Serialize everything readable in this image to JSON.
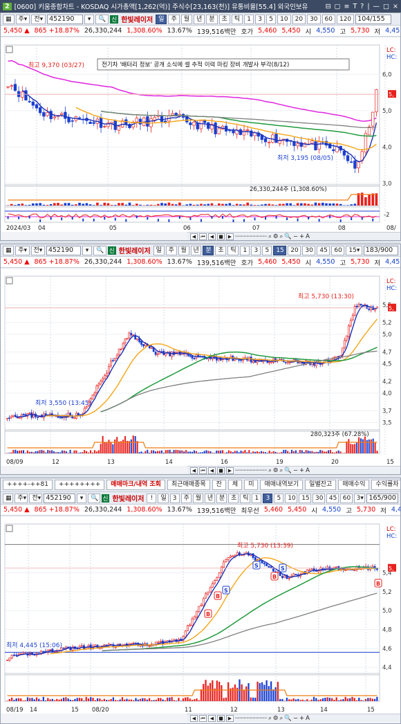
{
  "window": {
    "num": "2",
    "title": "[0600] 키움종합차트 - KOSDAQ 시가총액[1,262(억)] 주식수[23,163(천)] 유통비율[55.4] 외국인보유",
    "controls": [
      "⊟",
      "▢",
      "≡",
      "T",
      "?",
      "|",
      "—",
      "□",
      "×"
    ]
  },
  "code": "452190",
  "stock_name": "한빛레이저",
  "market_badge": "신",
  "quote": {
    "price": "5,450",
    "change": "865",
    "rate": "+18.87%",
    "volume": "26,330,244",
    "vol_rate": "1,308.60%",
    "turnover": "13.67%",
    "amount": "139,516백만",
    "ask_label": "호가",
    "ask": "5,460",
    "bid": "5,450",
    "open_label": "시",
    "open": "4,550",
    "high_label": "고",
    "high": "5,730",
    "low_label": "저",
    "low": "4,45",
    "alt_label": "최우선"
  },
  "panels": [
    {
      "period_buttons": [
        "일",
        "주",
        "월",
        "년",
        "분",
        "초",
        "틱"
      ],
      "active_period": "일",
      "num_buttons": [
        "1",
        "3",
        "5",
        "10",
        "20",
        "30",
        "60",
        "120"
      ],
      "counter": "104/155",
      "annotation": "전기차 '배터리 정보' 공개 소식에 셀 추적 이력 마킹 장비 개발사 부각(8/12)",
      "high_note": "최고 9,370 (03/27)",
      "low_note": "최저 3,195 (08/05)",
      "price_ticks": [
        "6,0",
        "5,0",
        "4,0",
        "3,0"
      ],
      "tag_lc": "LC:",
      "tag_hc": "HC:",
      "vol_note": "26,330,244주 (1,308.60%)",
      "ind_ticks": [
        "-2"
      ],
      "date_labels": [
        "2024/03",
        "04",
        "05",
        "06",
        "07",
        "08",
        "08/"
      ],
      "chart_data": {
        "type": "candlestick",
        "interval": "daily",
        "title": "",
        "x_labels": [
          "2024/03",
          "04",
          "05",
          "06",
          "07",
          "08"
        ],
        "ylim": [
          3000,
          6500
        ],
        "highest": {
          "value": 9370,
          "date": "03/27"
        },
        "lowest": {
          "value": 3195,
          "date": "08/05"
        },
        "last": 5450
      }
    },
    {
      "period_buttons": [
        "일",
        "주",
        "월",
        "년",
        "분",
        "초",
        "틱"
      ],
      "active_period": "분",
      "num_buttons": [
        "1",
        "3",
        "5",
        "15",
        "20",
        "30",
        "45",
        "60"
      ],
      "active_num": "15",
      "select": "15",
      "counter": "183/900",
      "high_note": "최고 5,730 (13:30)",
      "low_note": "최저 3,550 (13:45)",
      "price_ticks": [
        "5,5",
        "5,2",
        "5,0",
        "4,7",
        "4,5",
        "4,2",
        "4,0",
        "3,7",
        "3,5"
      ],
      "tag_lc": "LC:",
      "tag_hc": "HC:",
      "vol_note": "280,323주 (67.28%)",
      "date_labels": [
        "08/09",
        "12",
        "13",
        "14",
        "16",
        "19",
        "20",
        "15"
      ],
      "chart_data": {
        "type": "candlestick",
        "interval": "15분",
        "title": "",
        "x_labels": [
          "08/09",
          "12",
          "13",
          "14",
          "16",
          "19",
          "20"
        ],
        "ylim": [
          3400,
          5800
        ],
        "highest": {
          "value": 5730,
          "time": "13:30"
        },
        "lowest": {
          "value": 3550,
          "time": "13:45"
        },
        "last": 5450
      }
    },
    {
      "topbar": {
        "field1": "++++-++81",
        "field2": "++++++++",
        "tab_active": "매매마크/내역 조회",
        "tabs": [
          "최근매매종목",
          "잔",
          "체",
          "미",
          "매매내역보기"
        ],
        "right_buttons": [
          "일별잔고",
          "매매수익",
          "수익률차"
        ]
      },
      "period_buttons": [
        "!",
        "일",
        "3",
        "주",
        "월",
        "년",
        "분",
        "초",
        "틱"
      ],
      "num_buttons": [
        "1",
        "3",
        "5",
        "10",
        "15",
        "30",
        "45",
        "60"
      ],
      "active_num": "3",
      "select": "3",
      "counter": "165/900",
      "high_note": "최고 5,730 (13:39)",
      "low_note": "최저 4,445 (15:06)",
      "price_ticks": [
        "5,4",
        "5,2",
        "5,0",
        "4,8",
        "4,6",
        "4,4"
      ],
      "tag_lc": "LC:",
      "tag_hc": "HC:",
      "date_labels": [
        "08/19",
        "14",
        "15",
        "08/20",
        "11",
        "12",
        "13",
        "14",
        "15"
      ],
      "chart_data": {
        "type": "candlestick",
        "interval": "3분",
        "title": "",
        "x_labels": [
          "08/19",
          "14",
          "15",
          "08/20",
          "11",
          "12",
          "13",
          "14",
          "15"
        ],
        "ylim": [
          4350,
          5800
        ],
        "highest": {
          "value": 5730,
          "time": "13:39"
        },
        "lowest": {
          "value": 4445,
          "time": "15:06"
        },
        "last": 5450,
        "markers": [
          "B",
          "S"
        ]
      }
    }
  ],
  "colors": {
    "up": "#e8201c",
    "down": "#1a3fd0",
    "ma5": "#1a2fb5",
    "ma20": "#f5a516",
    "ma60": "#1f9a3c",
    "ma120": "#808080",
    "envelope": "#e030e0"
  },
  "icons": [
    "dropdown-icon",
    "search-icon",
    "chart-icon",
    "stop-icon",
    "play-icon",
    "zoom-icon",
    "minus-icon",
    "plus-icon"
  ]
}
